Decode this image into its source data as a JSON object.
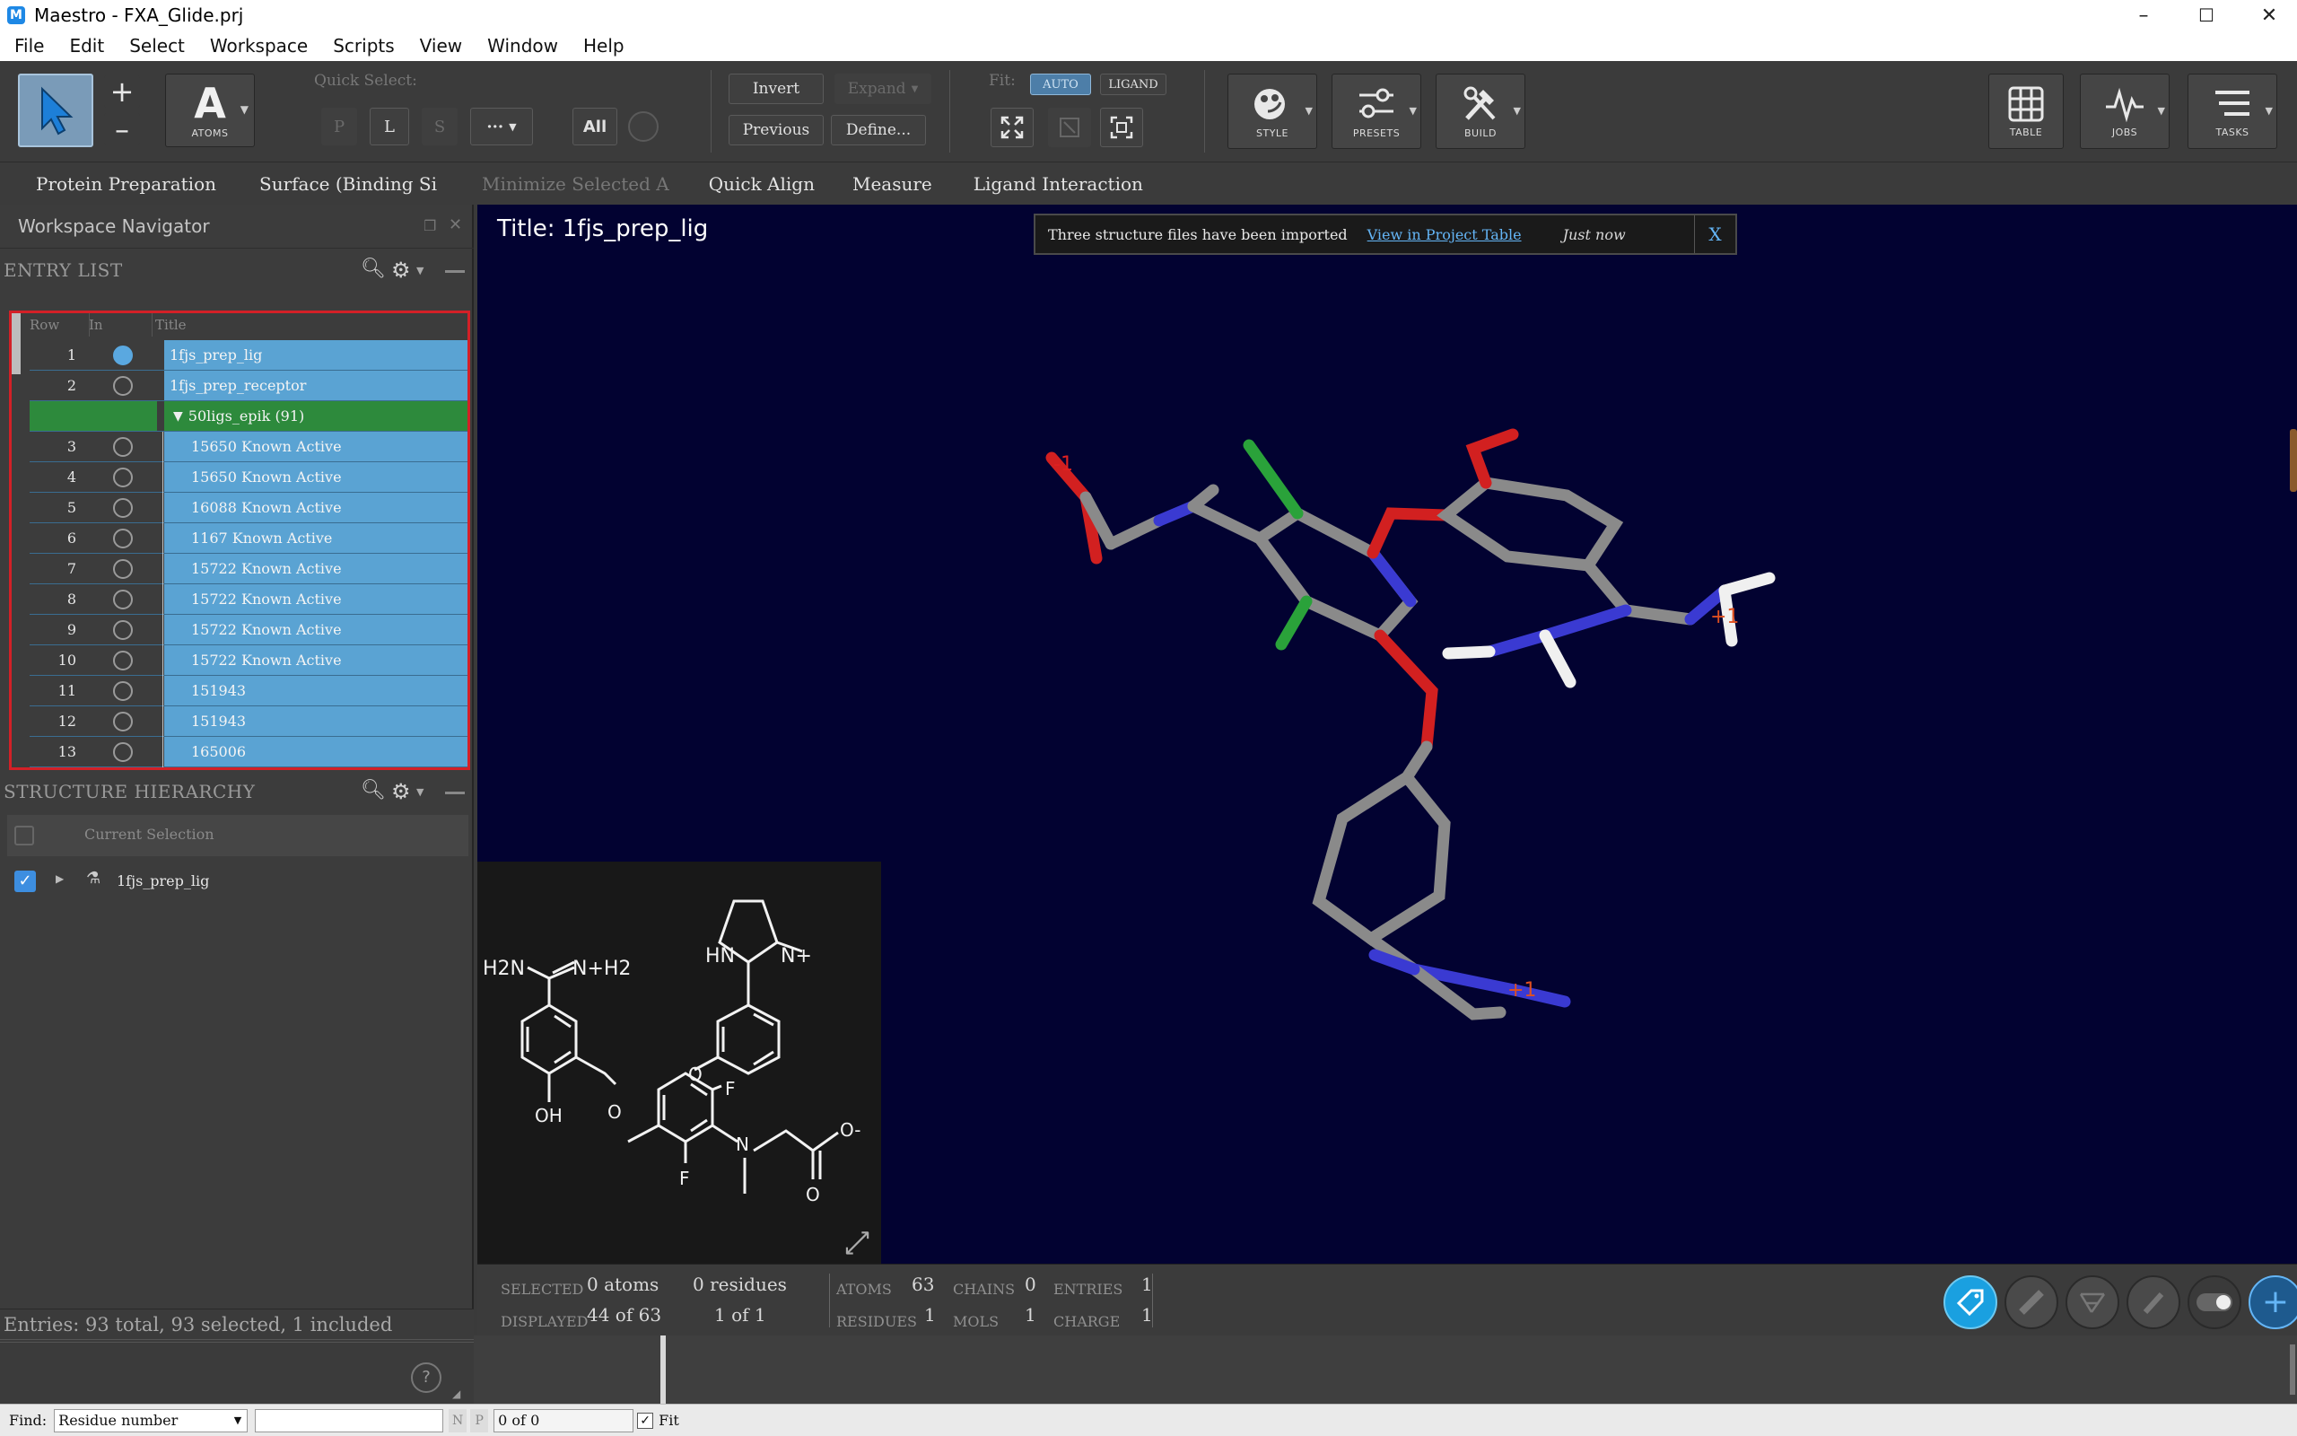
{
  "window": {
    "title": "Maestro - FXA_Glide.prj",
    "app_icon": "M",
    "minimize": "–",
    "maximize": "☐",
    "close": "✕"
  },
  "menu": [
    "File",
    "Edit",
    "Select",
    "Workspace",
    "Scripts",
    "View",
    "Window",
    "Help"
  ],
  "toolbar": {
    "atoms_caption": "ATOMS",
    "quick_select_label": "Quick Select:",
    "quick_p": "P",
    "quick_l": "L",
    "quick_s": "S",
    "quick_more": "···",
    "quick_all": "All",
    "invert": "Invert",
    "expand": "Expand",
    "previous": "Previous",
    "define": "Define...",
    "fit_label": "Fit:",
    "fit_auto": "AUTO",
    "fit_ligand": "LIGAND",
    "style": "STYLE",
    "presets": "PRESETS",
    "build": "BUILD",
    "table": "TABLE",
    "jobs": "JOBS",
    "tasks": "TASKS"
  },
  "favorites": [
    "Protein Preparation",
    "Surface (Binding Si",
    "Minimize Selected A",
    "Quick Align",
    "Measure",
    "Ligand Interaction"
  ],
  "navigator": {
    "title": "Workspace Navigator",
    "entry_list": "ENTRY LIST",
    "columns": {
      "row": "Row",
      "in": "In",
      "title": "Title"
    },
    "rows": [
      {
        "row": "1",
        "title": "1fjs_prep_lig",
        "included": true,
        "group": false,
        "child": false
      },
      {
        "row": "2",
        "title": "1fjs_prep_receptor",
        "included": false,
        "group": false,
        "child": false
      },
      {
        "row": "",
        "title": "50ligs_epik (91)",
        "included": null,
        "group": true,
        "child": false
      },
      {
        "row": "3",
        "title": "15650 Known Active",
        "included": false,
        "group": false,
        "child": true
      },
      {
        "row": "4",
        "title": "15650 Known Active",
        "included": false,
        "group": false,
        "child": true
      },
      {
        "row": "5",
        "title": "16088 Known Active",
        "included": false,
        "group": false,
        "child": true
      },
      {
        "row": "6",
        "title": "1167 Known Active",
        "included": false,
        "group": false,
        "child": true
      },
      {
        "row": "7",
        "title": "15722 Known Active",
        "included": false,
        "group": false,
        "child": true
      },
      {
        "row": "8",
        "title": "15722 Known Active",
        "included": false,
        "group": false,
        "child": true
      },
      {
        "row": "9",
        "title": "15722 Known Active",
        "included": false,
        "group": false,
        "child": true
      },
      {
        "row": "10",
        "title": "15722 Known Active",
        "included": false,
        "group": false,
        "child": true
      },
      {
        "row": "11",
        "title": "151943",
        "included": false,
        "group": false,
        "child": true
      },
      {
        "row": "12",
        "title": "151943",
        "included": false,
        "group": false,
        "child": true
      },
      {
        "row": "13",
        "title": "165006",
        "included": false,
        "group": false,
        "child": true
      }
    ],
    "structure_hierarchy": "STRUCTURE HIERARCHY",
    "current_selection": "Current Selection",
    "hierarchy_item": "1fjs_prep_lig",
    "entries_summary": "Entries: 93 total, 93 selected, 1 included"
  },
  "viewport": {
    "title": "Title: 1fjs_prep_lig",
    "notice": {
      "text": "Three structure files have been imported",
      "link": "View in Project Table",
      "time": "Just now",
      "close": "X"
    },
    "charges": {
      "neg": "-1",
      "pos1": "+1",
      "pos2": "+1"
    },
    "atoms_2d": {
      "hn": "HN",
      "n_plus": "N+",
      "h2n": "H2N",
      "nh2": "N+H2",
      "o1": "O",
      "o2": "O",
      "f1": "F",
      "f2": "F",
      "oh": "OH",
      "n": "N",
      "o3": "O-",
      "o4": "O"
    }
  },
  "status": {
    "selected_label": "SELECTED",
    "displayed_label": "DISPLAYED",
    "sel_atoms": "0 atoms",
    "sel_residues": "0 residues",
    "disp_atoms": "44 of 63",
    "disp_residues": "1 of 1",
    "atoms_label": "ATOMS",
    "atoms_val": "63",
    "chains_label": "CHAINS",
    "chains_val": "0",
    "entries_label": "ENTRIES",
    "entries_val": "1",
    "residues_label": "RESIDUES",
    "residues_val": "1",
    "mols_label": "MOLS",
    "mols_val": "1",
    "charge_label": "CHARGE",
    "charge_val": "1"
  },
  "findbar": {
    "label": "Find:",
    "mode": "Residue number",
    "query": "",
    "next": "N",
    "prev": "P",
    "count": "0 of 0",
    "fit": "Fit"
  },
  "help": "?",
  "colors": {
    "viewport_bg": "#020231",
    "selection_blue": "#5aa3d3",
    "group_green": "#2d8a3c",
    "highlight_red": "#d32027"
  }
}
